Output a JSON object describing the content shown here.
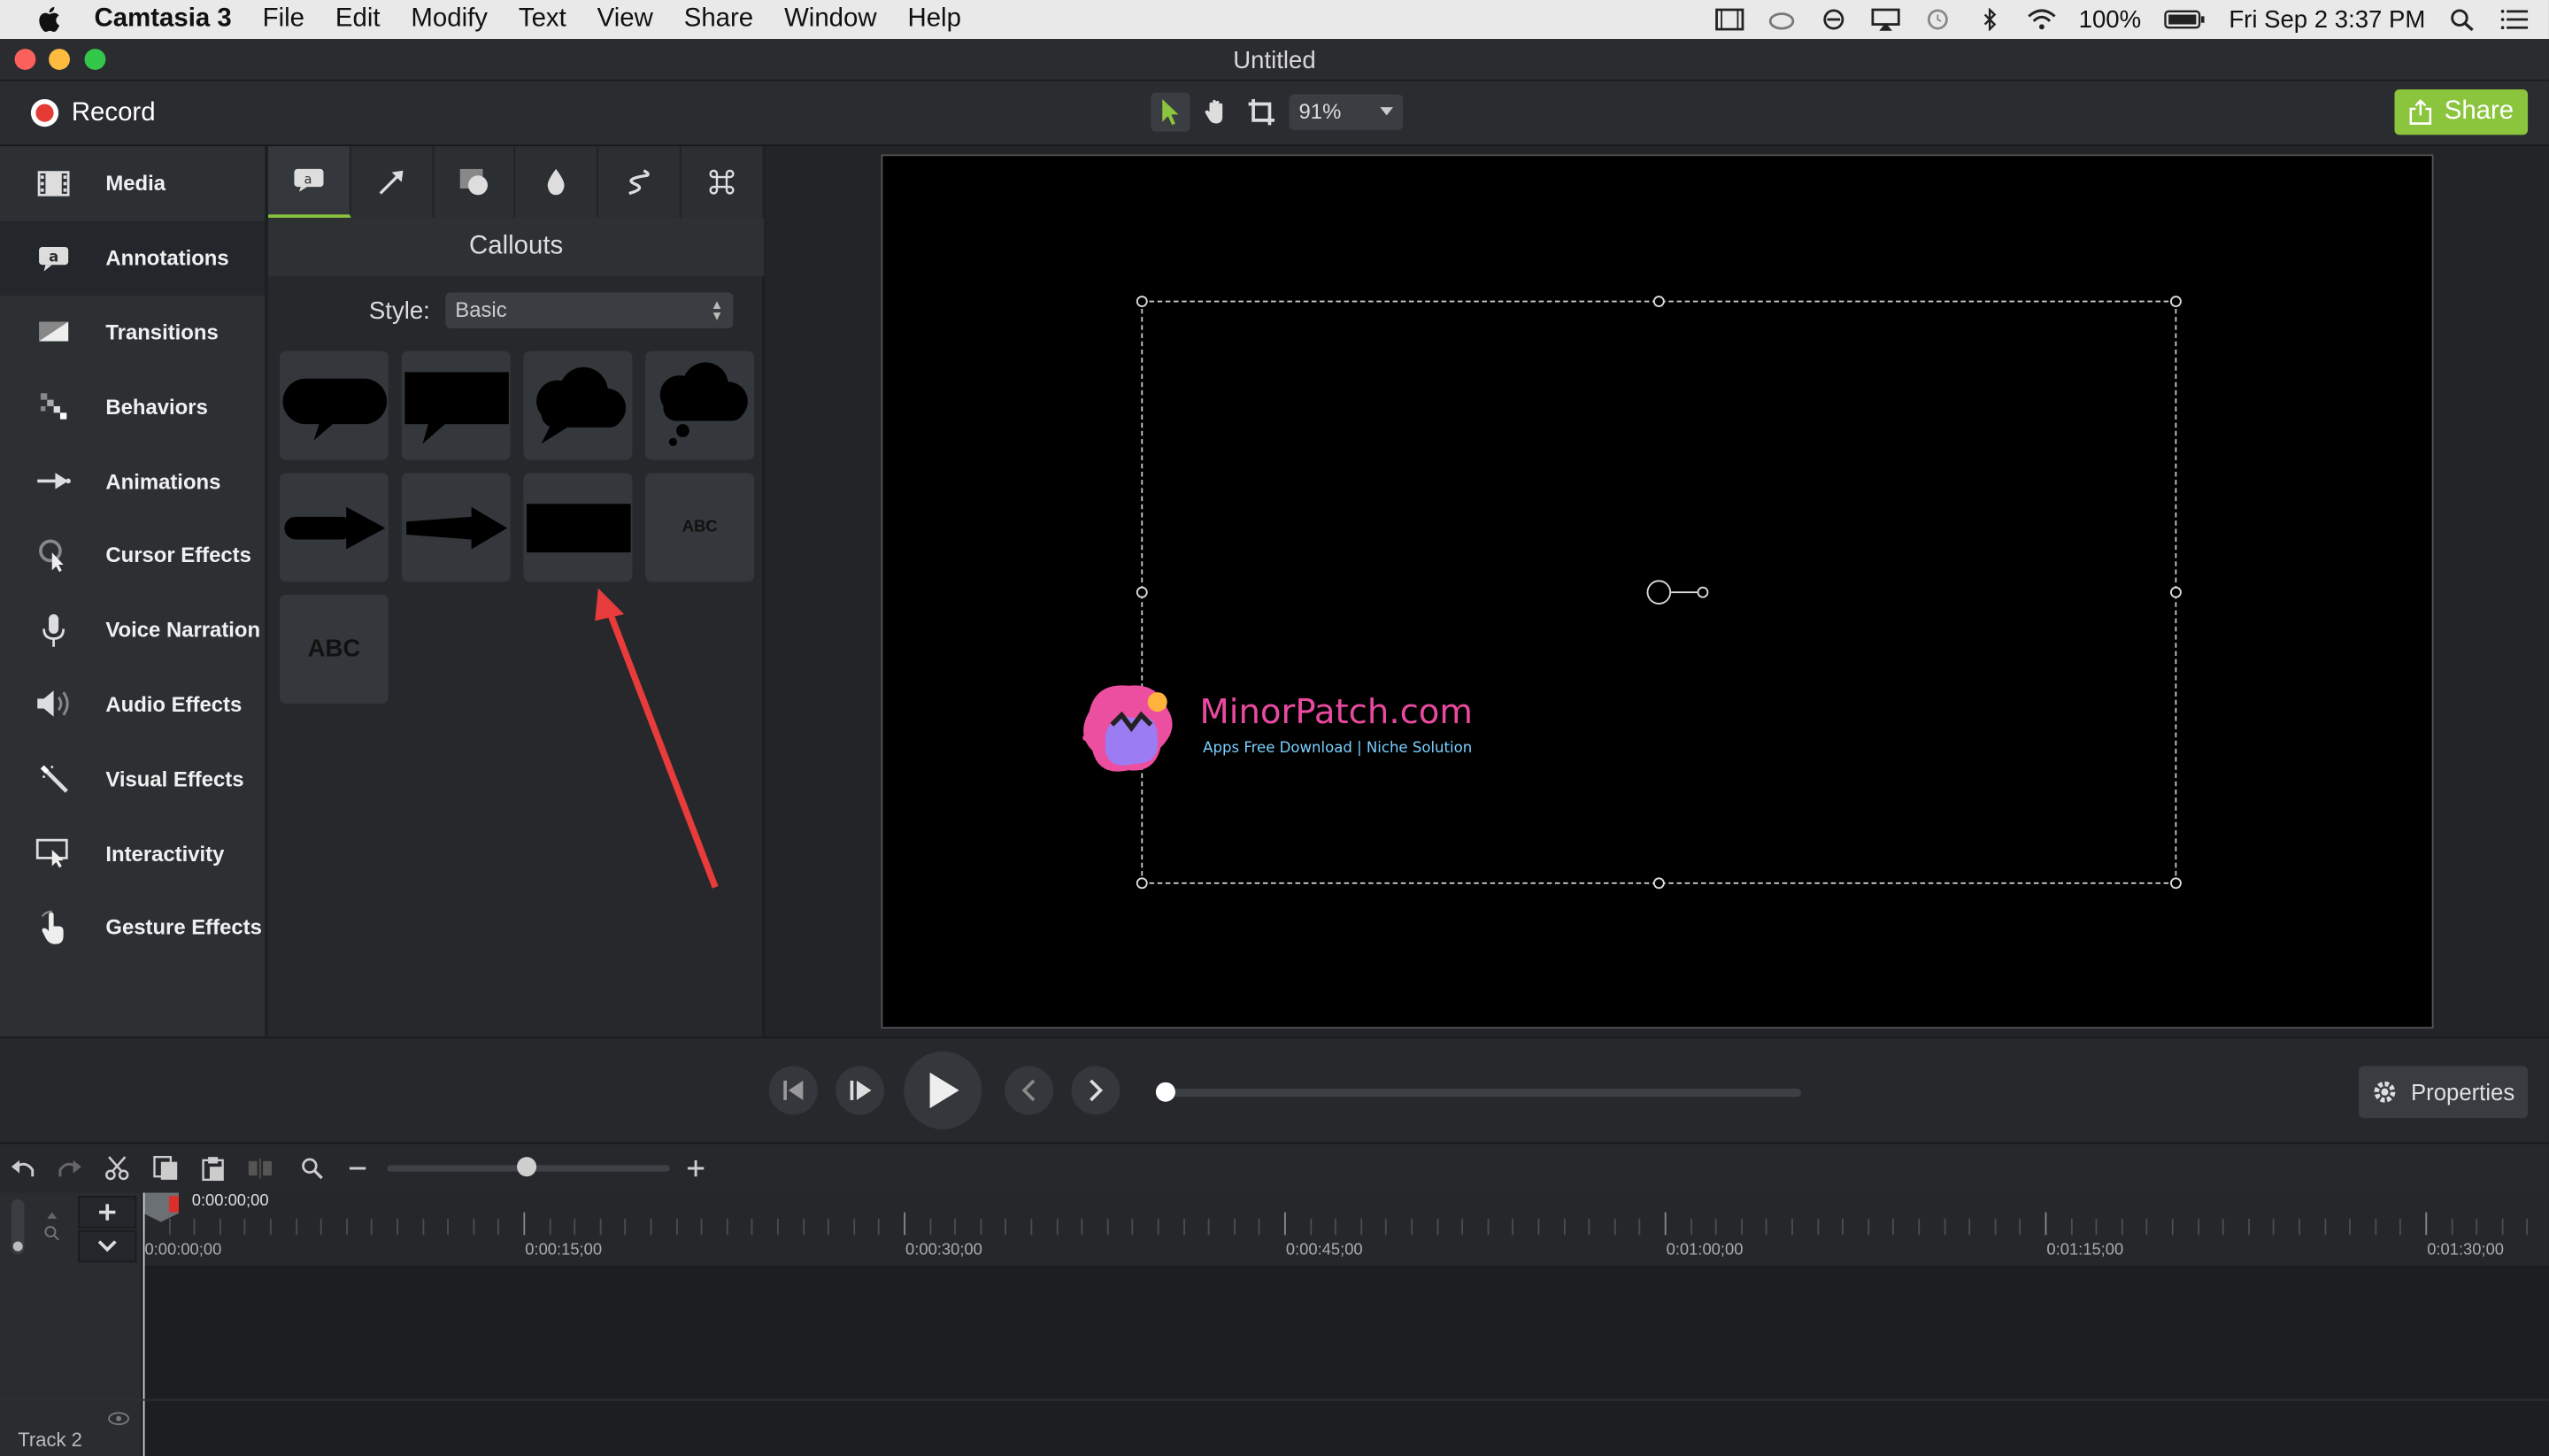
{
  "menubar": {
    "app": "Camtasia 3",
    "items": [
      "File",
      "Edit",
      "Modify",
      "Text",
      "View",
      "Share",
      "Window",
      "Help"
    ],
    "battery": "100%",
    "datetime": "Fri Sep 2  3:37 PM"
  },
  "window": {
    "title": "Untitled"
  },
  "toolbar": {
    "record_label": "Record",
    "zoom": "91%",
    "share_label": "Share",
    "accent": "#8bc43d",
    "record_color": "#e63a36"
  },
  "sidebar": {
    "items": [
      {
        "label": "Media",
        "icon": "film-icon"
      },
      {
        "label": "Annotations",
        "icon": "annotation-icon",
        "active": true
      },
      {
        "label": "Transitions",
        "icon": "transition-icon"
      },
      {
        "label": "Behaviors",
        "icon": "behaviors-icon"
      },
      {
        "label": "Animations",
        "icon": "animation-arrow-icon"
      },
      {
        "label": "Cursor Effects",
        "icon": "cursor-effect-icon"
      },
      {
        "label": "Voice Narration",
        "icon": "microphone-icon"
      },
      {
        "label": "Audio Effects",
        "icon": "speaker-icon"
      },
      {
        "label": "Visual Effects",
        "icon": "magic-wand-icon"
      },
      {
        "label": "Interactivity",
        "icon": "interactivity-icon"
      },
      {
        "label": "Gesture Effects",
        "icon": "hand-gesture-icon"
      }
    ]
  },
  "panel": {
    "tabs": [
      "callout-icon",
      "arrow-icon",
      "shape-icon",
      "blur-icon",
      "sketch-icon",
      "keystroke-icon"
    ],
    "title": "Callouts",
    "style_label": "Style:",
    "style_value": "Basic",
    "tiles": [
      "speech-bubble",
      "speech-box",
      "thought-cloud",
      "thought-cloud-dots",
      "arrow-fat",
      "arrow-tapered",
      "rectangle",
      "ABC",
      "ABC"
    ],
    "abc_small": "ABC",
    "abc_large": "ABC"
  },
  "watermark": {
    "title": "MinorPatch.com",
    "subtitle": "Apps Free Download | Niche Solution"
  },
  "playback": {
    "properties_label": "Properties"
  },
  "timeline": {
    "playhead_time": "0:00:00;00",
    "ticks": [
      "0:00:00;00",
      "0:00:15;00",
      "0:00:30;00",
      "0:00:45;00",
      "0:01:00;00",
      "0:01:15;00",
      "0:01:30;00"
    ],
    "track_label": "Track 2"
  }
}
